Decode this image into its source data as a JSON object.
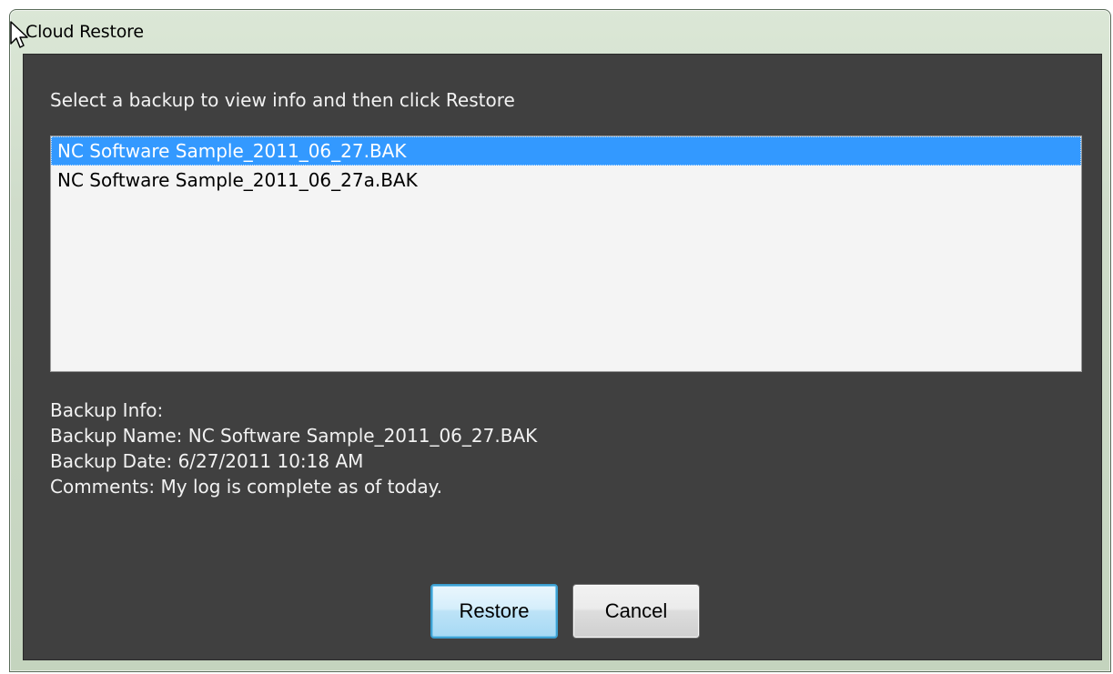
{
  "window": {
    "title": "Cloud Restore"
  },
  "dialog": {
    "instruction": "Select a backup to view info and then click Restore",
    "backups": [
      {
        "name": "NC Software Sample_2011_06_27.BAK",
        "selected": true
      },
      {
        "name": "NC Software Sample_2011_06_27a.BAK",
        "selected": false
      }
    ],
    "info": {
      "heading": "Backup Info:",
      "name_line": "Backup Name: NC Software Sample_2011_06_27.BAK",
      "date_line": "Backup Date: 6/27/2011 10:18 AM",
      "comments_line": "Comments: My log is complete as of today."
    },
    "buttons": {
      "restore_label": "Restore",
      "cancel_label": "Cancel"
    }
  },
  "colors": {
    "client_background": "#404040",
    "selection": "#3399ff",
    "list_background": "#f4f4f4"
  },
  "icons": {
    "cursor": "mouse-pointer-icon"
  }
}
